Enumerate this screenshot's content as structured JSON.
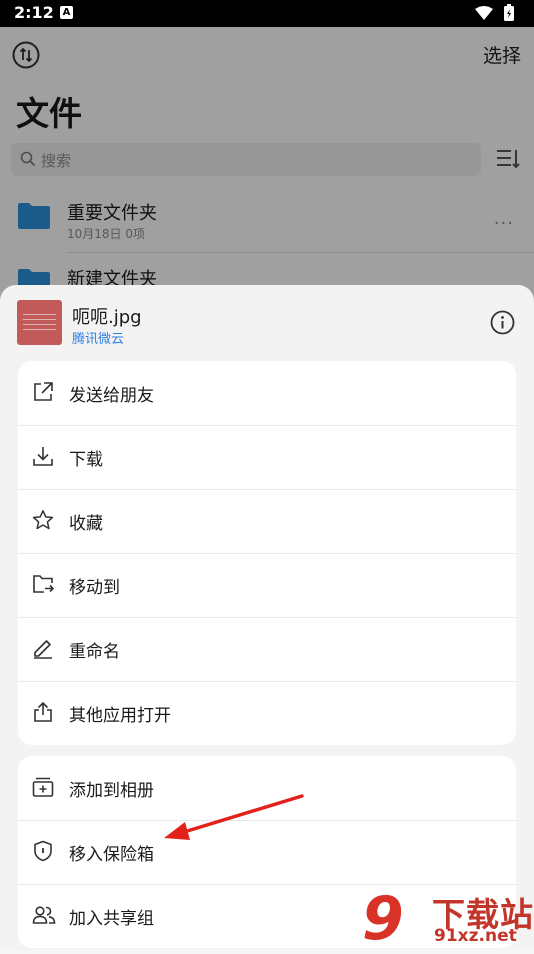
{
  "status_bar": {
    "time": "2:12",
    "notification_badge": "A",
    "icons": [
      "wifi-icon",
      "battery-icon"
    ]
  },
  "header": {
    "select_label": "选择",
    "title": "文件"
  },
  "search": {
    "placeholder": "搜索"
  },
  "files": [
    {
      "name": "重要文件夹",
      "meta": "10月18日 0项",
      "more": "···"
    },
    {
      "name": "新建文件夹",
      "meta": "",
      "more": ""
    }
  ],
  "sheet": {
    "file_name": "呃呃.jpg",
    "file_source": "腾讯微云",
    "primary_actions": [
      {
        "label": "发送给朋友",
        "icon": "share-icon"
      },
      {
        "label": "下载",
        "icon": "download-icon"
      },
      {
        "label": "收藏",
        "icon": "star-icon"
      },
      {
        "label": "移动到",
        "icon": "move-folder-icon"
      },
      {
        "label": "重命名",
        "icon": "pencil-icon"
      },
      {
        "label": "其他应用打开",
        "icon": "open-with-icon"
      }
    ],
    "secondary_actions": [
      {
        "label": "添加到相册",
        "icon": "album-icon"
      },
      {
        "label": "移入保险箱",
        "icon": "safe-shield-icon"
      },
      {
        "label": "加入共享组",
        "icon": "group-icon"
      }
    ]
  },
  "watermark": {
    "logo": "9",
    "text_cn": "下载站",
    "text_en": "91xz.net"
  },
  "colors": {
    "accent": "#2f7fe3",
    "folder": "#2a8fd6",
    "annotation_arrow": "#e3201b"
  }
}
